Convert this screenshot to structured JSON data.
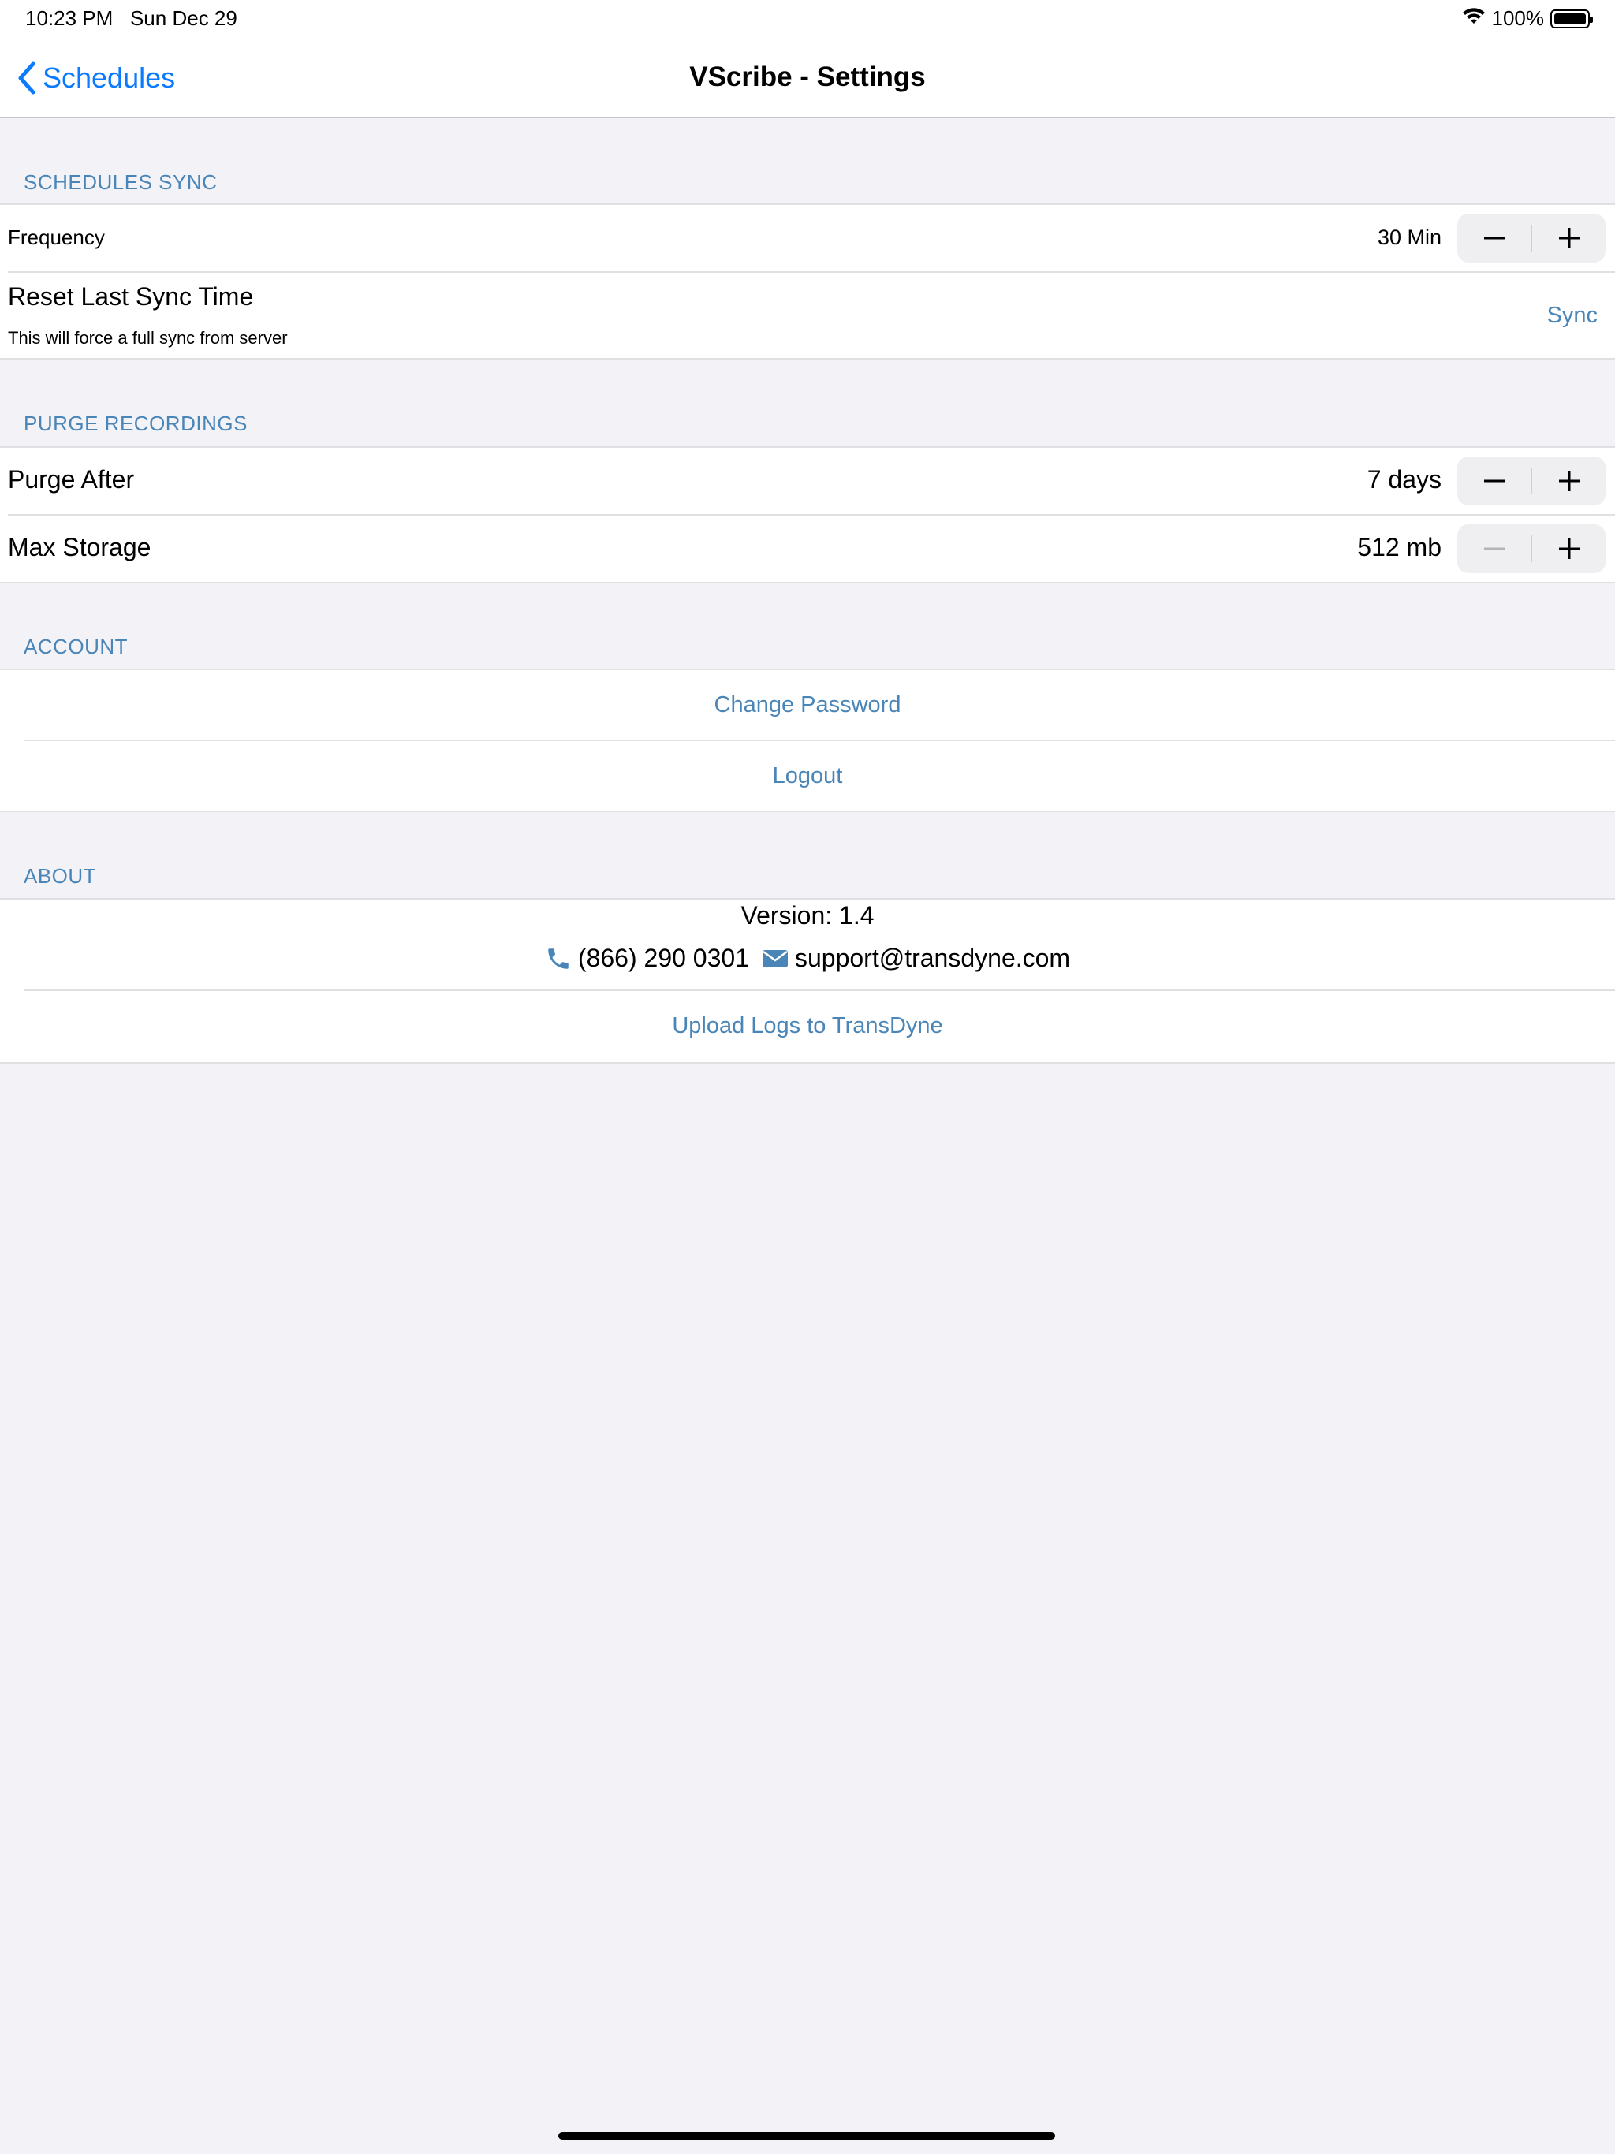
{
  "status": {
    "time": "10:23 PM",
    "date": "Sun Dec 29",
    "battery": "100%"
  },
  "nav": {
    "back_label": "Schedules",
    "title": "VScribe - Settings"
  },
  "schedules_sync": {
    "header": "SCHEDULES SYNC",
    "frequency_label": "Frequency",
    "frequency_value": "30 Min",
    "reset_label": "Reset Last Sync Time",
    "reset_sub": "This will force a full sync from server",
    "sync_button": "Sync"
  },
  "purge": {
    "header": "PURGE RECORDINGS",
    "purge_after_label": "Purge After",
    "purge_after_value": "7 days",
    "max_storage_label": "Max Storage",
    "max_storage_value": "512 mb"
  },
  "account": {
    "header": "ACCOUNT",
    "change_password": "Change Password",
    "logout": "Logout"
  },
  "about": {
    "header": "ABOUT",
    "version": "Version: 1.4",
    "phone": "(866) 290 0301",
    "email": "support@transdyne.com",
    "upload_logs": "Upload Logs to TransDyne"
  },
  "colors": {
    "accent": "#4a85b8",
    "back_blue": "#0a7aff",
    "background": "#f2f2f7"
  }
}
